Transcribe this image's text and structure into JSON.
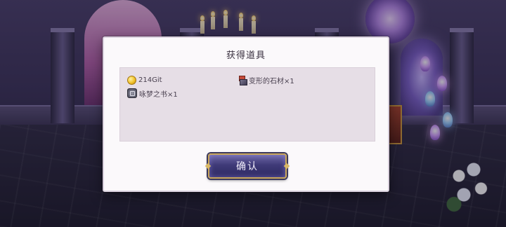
{
  "dialog": {
    "title": "获得道具",
    "items": [
      {
        "icon": "gold-coin-icon",
        "label": "214Git"
      },
      {
        "icon": "stone-material-icon",
        "label": "变形的石材×1"
      },
      {
        "icon": "book-icon",
        "label": "咏梦之书×1"
      }
    ],
    "confirm_label": "确认"
  }
}
